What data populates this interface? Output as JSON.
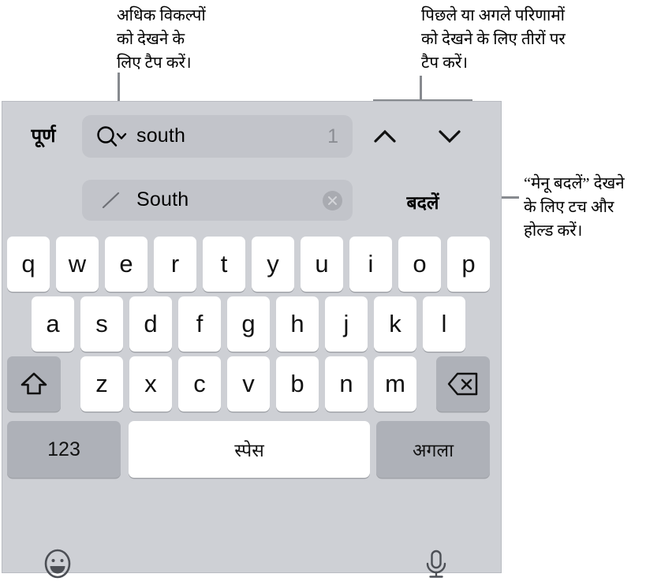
{
  "annotations": {
    "more_options": "अधिक विकल्पों\nको देखने के\nलिए टैप करें।",
    "arrows": "पिछले या अगले परिणामों\nको देखने के लिए तीरों पर\nटैप करें।",
    "replace_menu": "“मेनू बदलें” देखने\nके लिए टच और\nहोल्ड करें।"
  },
  "find_bar": {
    "done_label": "पूर्ण",
    "search_value": "south",
    "search_icon": "search-magnifier-with-chevron-icon",
    "match_count": "1",
    "prev_icon": "chevron-up-icon",
    "next_icon": "chevron-down-icon"
  },
  "replace_bar": {
    "pencil_icon": "pencil-edit-icon",
    "replace_value": "South",
    "clear_icon": "clear-circle-x-icon",
    "replace_label": "बदलें"
  },
  "keyboard": {
    "row1": [
      "q",
      "w",
      "e",
      "r",
      "t",
      "y",
      "u",
      "i",
      "o",
      "p"
    ],
    "row2": [
      "a",
      "s",
      "d",
      "f",
      "g",
      "h",
      "j",
      "k",
      "l"
    ],
    "row3": [
      "z",
      "x",
      "c",
      "v",
      "b",
      "n",
      "m"
    ],
    "shift_icon": "shift-up-arrow-icon",
    "backspace_icon": "backspace-delete-icon",
    "numeric_label": "123",
    "space_label": "स्पेस",
    "next_label": "अगला",
    "emoji_icon": "emoji-smiley-icon",
    "dictation_icon": "microphone-icon"
  },
  "colors": {
    "panel_background": "#ced0d5",
    "field_background": "#c2c4ca",
    "key_light": "#ffffff",
    "key_dark": "#aeb1b8",
    "leader_line": "#878a8f",
    "muted_text": "#8b8d93"
  }
}
